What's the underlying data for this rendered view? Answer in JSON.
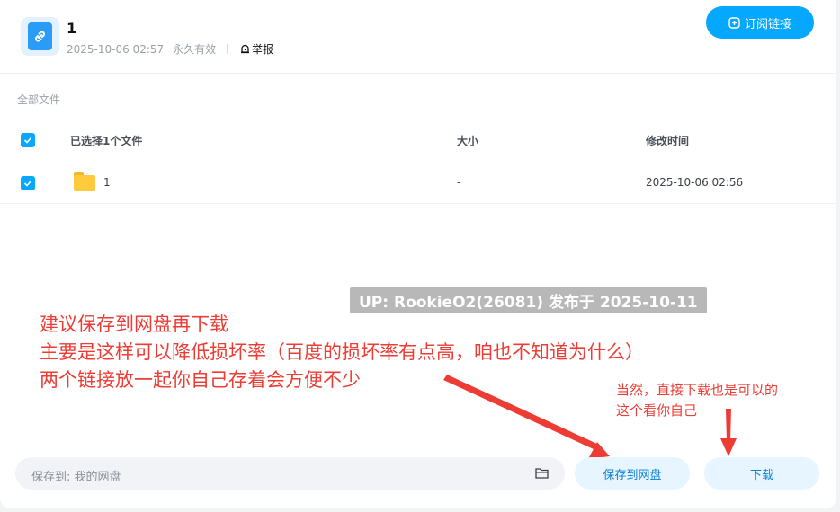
{
  "share": {
    "title": "1",
    "date": "2025-10-06 02:57",
    "validity": "永久有效",
    "report_label": "举报",
    "subscribe_label": "订阅链接"
  },
  "list": {
    "breadcrumb": "全部文件",
    "columns": {
      "name": "已选择1个文件",
      "size": "大小",
      "modified": "修改时间"
    },
    "rows": [
      {
        "name": "1",
        "size": "-",
        "modified": "2025-10-06 02:56",
        "checked": true
      }
    ]
  },
  "annotations": {
    "watermark": "UP: RookieO2(26081) 发布于 2025-10-11",
    "main_note": [
      "建议保存到网盘再下载",
      "主要是这样可以降低损坏率（百度的损坏率有点高，咱也不知道为什么）",
      "两个链接放一起你自己存着会方便不少"
    ],
    "side_note": [
      "当然，直接下载也是可以的",
      "这个看你自己"
    ],
    "color": "#ec3c34"
  },
  "bottom": {
    "save_prefix": "保存到:",
    "save_target": "我的网盘",
    "save_button": "保存到网盘",
    "download_button": "下载"
  },
  "colors": {
    "accent": "#06a7ff",
    "light_button": "#e6f5ff"
  },
  "icons": [
    "link-file-icon",
    "report-icon",
    "add-circle-icon",
    "check-icon",
    "folder-icon",
    "folder-open-icon"
  ]
}
